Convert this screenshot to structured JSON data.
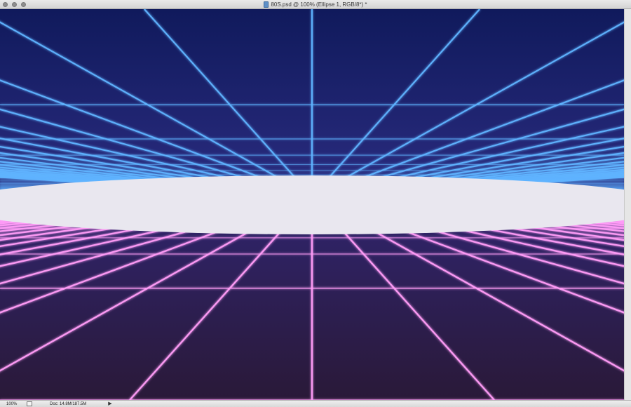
{
  "window": {
    "title": "80S.psd @ 100% (Ellipse 1, RGB/8*) *",
    "buttons": [
      "close",
      "minimize",
      "zoom"
    ]
  },
  "icons": {
    "document": "psd-document-icon",
    "export": "export-icon",
    "menu_arrow": "triangle-right-icon"
  },
  "statusbar": {
    "zoom": "100%",
    "doc_size": "Doc: 14.8M/187.5M",
    "arrow": "▶"
  },
  "colors": {
    "sky_top": "#111a5e",
    "sky_bottom": "#2a2a7e",
    "floor_top": "#2f2470",
    "floor_bottom": "#2a1a3a",
    "grid_blue": "#5fb3ff",
    "grid_pink": "#ff9cf7",
    "ellipse": "#e8e6ee"
  }
}
